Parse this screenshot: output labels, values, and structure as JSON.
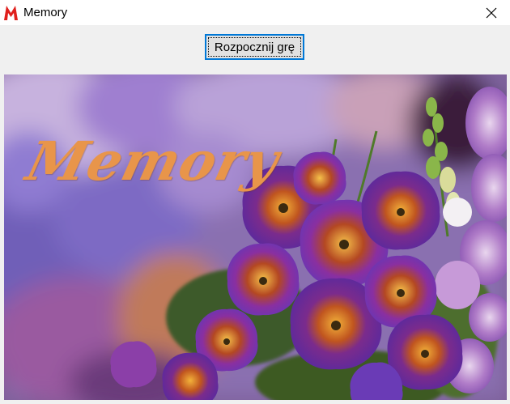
{
  "window": {
    "title": "Memory",
    "icon": "red-m-logo-icon",
    "close_icon": "close-icon"
  },
  "toolbar": {
    "start_label": "Rozpocznij grę"
  },
  "image": {
    "logo_text": "Memory",
    "subject": "purple and orange petunia flowers",
    "logo_color": "#e8954a"
  },
  "colors": {
    "focus_border": "#0078d7",
    "icon_red": "#e0201d"
  }
}
